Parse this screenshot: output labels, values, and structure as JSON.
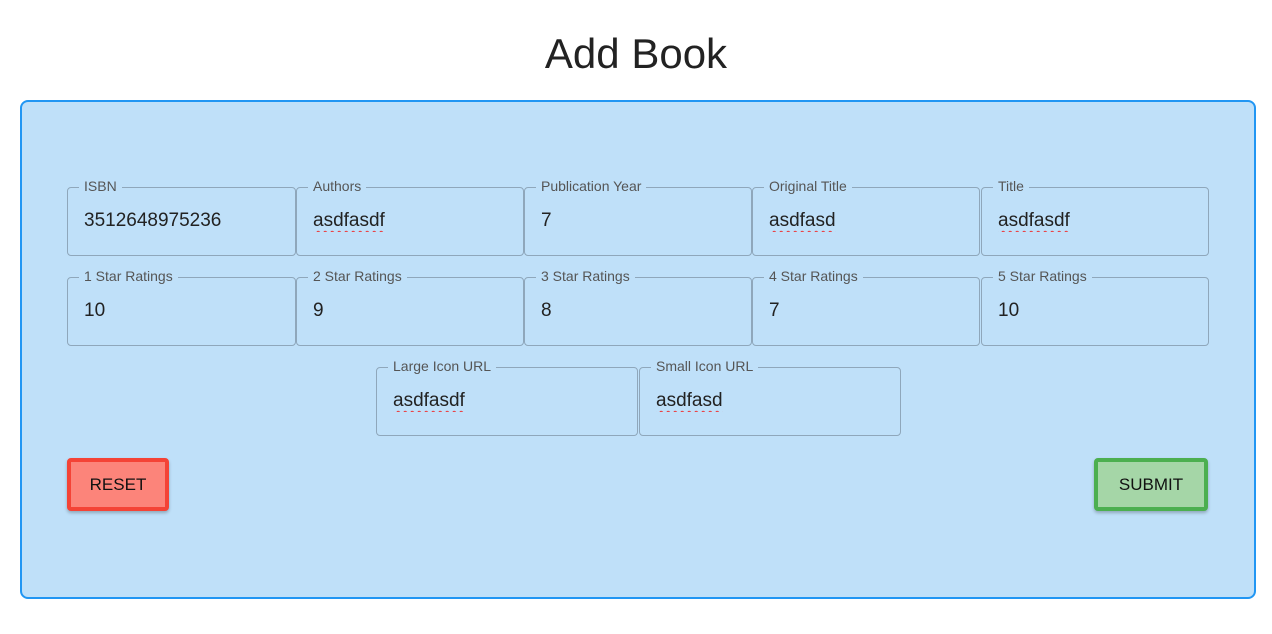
{
  "page_title": "Add Book",
  "fields": [
    {
      "label": "ISBN",
      "value": "3512648975236",
      "spell": false
    },
    {
      "label": "Authors",
      "value": "asdfasdf",
      "spell": true
    },
    {
      "label": "Publication Year",
      "value": "7",
      "spell": false
    },
    {
      "label": "Original Title",
      "value": "asdfasd",
      "spell": true
    },
    {
      "label": "Title",
      "value": "asdfasdf",
      "spell": true
    },
    {
      "label": "1 Star Ratings",
      "value": "10",
      "spell": false
    },
    {
      "label": "2 Star Ratings",
      "value": "9",
      "spell": false
    },
    {
      "label": "3 Star Ratings",
      "value": "8",
      "spell": false
    },
    {
      "label": "4 Star Ratings",
      "value": "7",
      "spell": false
    },
    {
      "label": "5 Star Ratings",
      "value": "10",
      "spell": false
    },
    {
      "label": "Large Icon URL",
      "value": "asdfasdf",
      "spell": true
    },
    {
      "label": "Small Icon URL",
      "value": "asdfasd",
      "spell": true
    }
  ],
  "buttons": {
    "reset": "RESET",
    "submit": "SUBMIT"
  },
  "colors": {
    "card_bg": "#bfe0f9",
    "card_border": "#2196f3",
    "reset": "#f44336",
    "submit": "#4caf50"
  }
}
